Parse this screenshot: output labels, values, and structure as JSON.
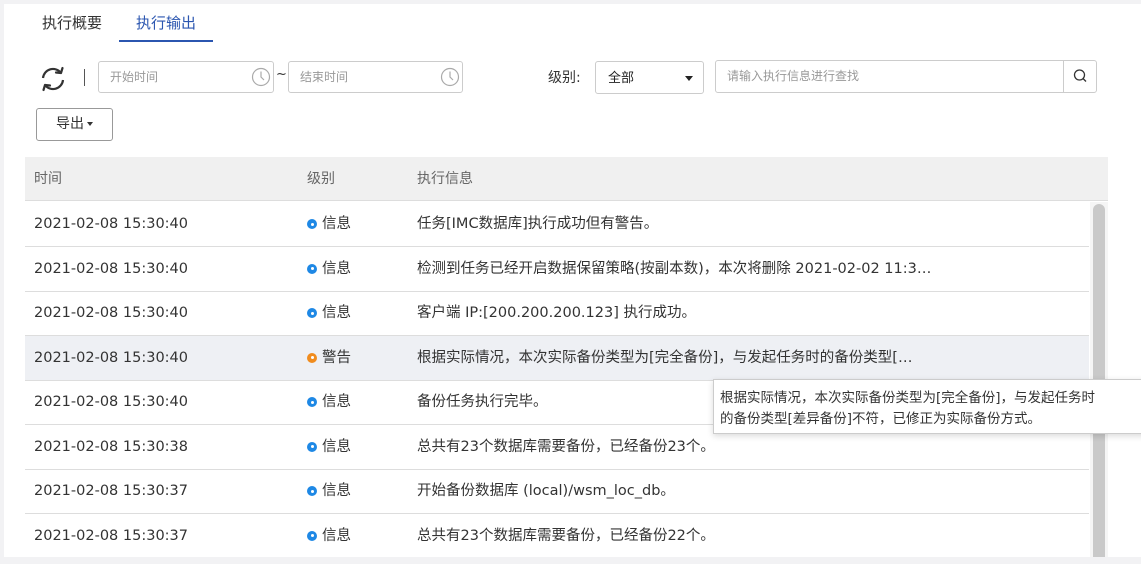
{
  "tabs": [
    {
      "label": "执行概要"
    },
    {
      "label": "执行输出"
    }
  ],
  "toolbar": {
    "start_placeholder": "开始时间",
    "tilde": "~",
    "end_placeholder": "结束时间",
    "level_label": "级别:",
    "level_value": "全部",
    "search_placeholder": "请输入执行信息进行查找",
    "export_label": "导出"
  },
  "table": {
    "headers": [
      "时间",
      "级别",
      "执行信息"
    ],
    "rows": [
      {
        "time": "2021-02-08 15:30:40",
        "level": "信息",
        "type": "info",
        "msg": "任务[IMC数据库]执行成功但有警告。"
      },
      {
        "time": "2021-02-08 15:30:40",
        "level": "信息",
        "type": "info",
        "msg": "检测到任务已经开启数据保留策略(按副本数)，本次将删除 2021-02-02 11:3…"
      },
      {
        "time": "2021-02-08 15:30:40",
        "level": "信息",
        "type": "info",
        "msg": "客户端 IP:[200.200.200.123] 执行成功。"
      },
      {
        "time": "2021-02-08 15:30:40",
        "level": "警告",
        "type": "warn",
        "msg": "根据实际情况，本次实际备份类型为[完全备份]，与发起任务时的备份类型[…"
      },
      {
        "time": "2021-02-08 15:30:40",
        "level": "信息",
        "type": "info",
        "msg": "备份任务执行完毕。"
      },
      {
        "time": "2021-02-08 15:30:38",
        "level": "信息",
        "type": "info",
        "msg": "总共有23个数据库需要备份，已经备份23个。"
      },
      {
        "time": "2021-02-08 15:30:37",
        "level": "信息",
        "type": "info",
        "msg": "开始备份数据库 (local)/wsm_loc_db。"
      },
      {
        "time": "2021-02-08 15:30:37",
        "level": "信息",
        "type": "info",
        "msg": "总共有23个数据库需要备份，已经备份22个。"
      }
    ]
  },
  "tooltip": {
    "line1": "根据实际情况，本次实际备份类型为[完全备份]，与发起任务时",
    "line2": "的备份类型[差异备份]不符，已修正为实际备份方式。"
  },
  "colors": {
    "accent": "#2b56b0",
    "info": "#1e88e5",
    "warn": "#f08c1e"
  },
  "icons": [
    "refresh-icon",
    "clock-icon",
    "search-icon",
    "caret-down-icon"
  ]
}
